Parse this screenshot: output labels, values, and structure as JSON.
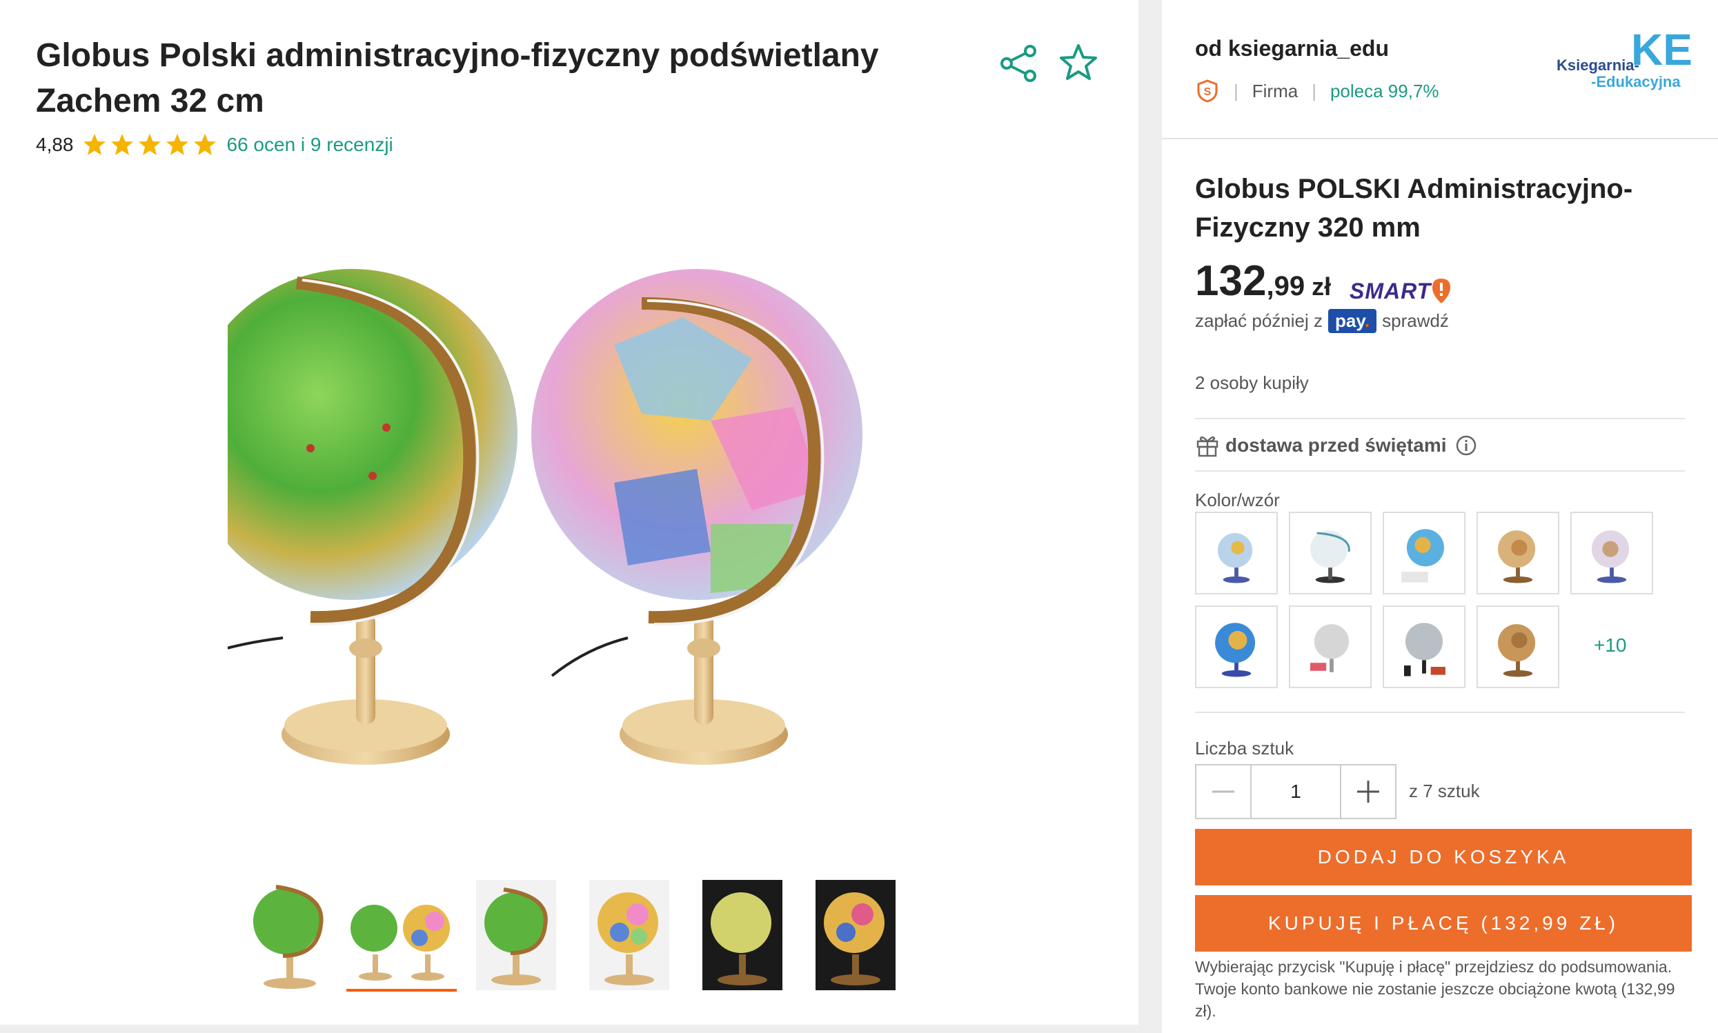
{
  "product": {
    "title": "Globus Polski administracyjno-fizyczny podświetlany Zachem 32 cm",
    "rating": "4,88",
    "stars": 5,
    "reviews_link": "66 ocen i 9 recenzji",
    "thumbnails": [
      "physical-globe",
      "two-globes",
      "physical-globe-white-bg",
      "political-globe",
      "physical-globe-lit",
      "political-globe-lit"
    ],
    "active_thumbnail": 1
  },
  "seller": {
    "name": "od ksiegarnia_edu",
    "type": "Firma",
    "recommend": "poleca 99,7%",
    "logo_line1": "Ksiegarnia-",
    "logo_line2": "-Edukacyjna",
    "logo_mark": "KE"
  },
  "offer": {
    "title": "Globus POLSKI Administracyjno-Fizyczny 320 mm",
    "price_int": "132",
    "price_dec": ",99",
    "currency": "zł",
    "smart": "SMART",
    "pay_prefix": "zapłać później z",
    "pay_brand": "pay",
    "pay_suffix": "sprawdź",
    "buyers": "2 osoby kupiły",
    "delivery": "dostawa przed świętami",
    "color_label": "Kolor/wzór",
    "more_variants": "+10",
    "qty_label": "Liczba sztuk",
    "qty_value": "1",
    "qty_of": "z 7 sztuk",
    "add_to_cart": "DODAJ DO KOSZYKA",
    "buy_now": "KUPUJĘ I PŁACĘ (132,99 ZŁ)",
    "note": "Wybierając przycisk \"Kupuję i płacę\" przejdziesz do podsumowania. Twoje konto bankowe nie zostanie jeszcze obciążone kwotą (132,99 zł)."
  },
  "colors": {
    "accent": "#ed6d2b",
    "link": "#1a9b82",
    "star": "#f5b400",
    "smart": "#3c2a8a"
  }
}
